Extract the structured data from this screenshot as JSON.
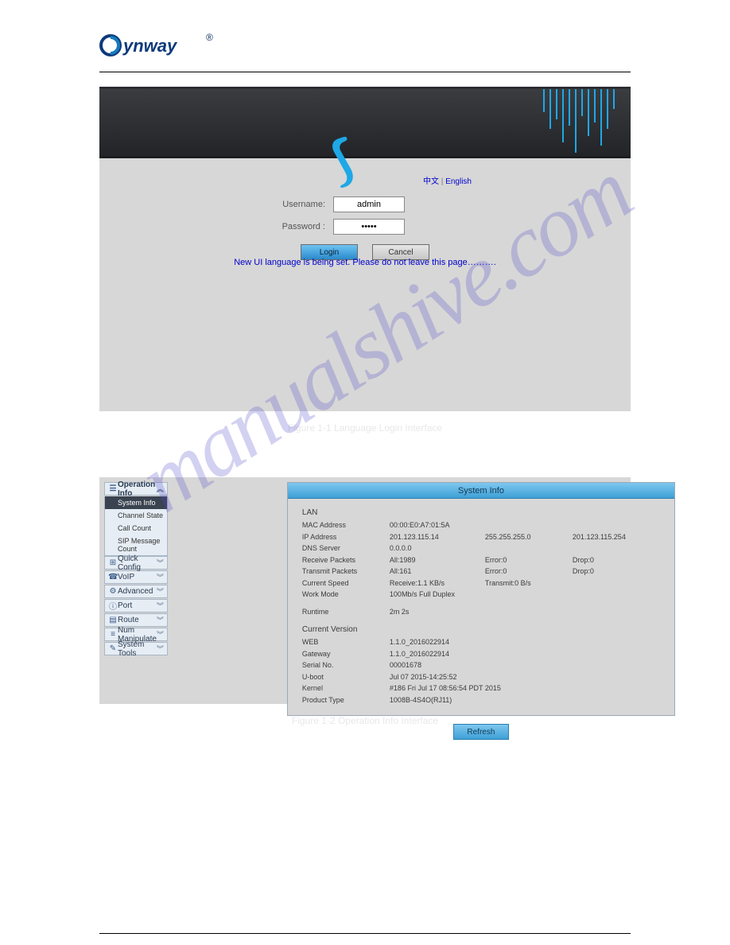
{
  "brand": "Synway",
  "login": {
    "lang_zh": "中文",
    "lang_sep": " | ",
    "lang_en": "English",
    "username_label": "Username:",
    "password_label": "Password :",
    "username_value": "admin",
    "password_value": "•••••",
    "login_btn": "Login",
    "cancel_btn": "Cancel",
    "loading_msg": "New UI language is being set. Please do not leave this page………."
  },
  "sidebar": {
    "groups": [
      {
        "icon": "☰",
        "label": "Operation Info",
        "expanded": true,
        "items": [
          "System Info",
          "Channel State",
          "Call Count",
          "SIP Message Count"
        ],
        "active_item": 0
      },
      {
        "icon": "⊞",
        "label": "Quick Config"
      },
      {
        "icon": "☎",
        "label": "VoIP"
      },
      {
        "icon": "⚙",
        "label": "Advanced"
      },
      {
        "icon": "ⓘ",
        "label": "Port"
      },
      {
        "icon": "▤",
        "label": "Route"
      },
      {
        "icon": "≡",
        "label": "Num Manipulate"
      },
      {
        "icon": "✎",
        "label": "System Tools"
      }
    ]
  },
  "system_info": {
    "title": "System Info",
    "lan_label": "LAN",
    "rows": {
      "mac": {
        "k": "MAC Address",
        "v1": "00:00:E0:A7:01:5A"
      },
      "ip": {
        "k": "IP Address",
        "v1": "201.123.115.14",
        "v2": "255.255.255.0",
        "v3": "201.123.115.254"
      },
      "dns": {
        "k": "DNS Server",
        "v1": "0.0.0.0"
      },
      "recv": {
        "k": "Receive Packets",
        "v1": "All:1989",
        "v2": "Error:0",
        "v3": "Drop:0"
      },
      "trans": {
        "k": "Transmit Packets",
        "v1": "All:161",
        "v2": "Error:0",
        "v3": "Drop:0"
      },
      "speed": {
        "k": "Current Speed",
        "v1": "Receive:1.1 KB/s",
        "v2": "Transmit:0 B/s"
      },
      "mode": {
        "k": "Work Mode",
        "v1": "100Mb/s Full Duplex"
      }
    },
    "runtime_label": "Runtime",
    "runtime_value": "2m 2s",
    "version_label": "Current Version",
    "versions": {
      "web": {
        "k": "WEB",
        "v": "1.1.0_2016022914"
      },
      "gateway": {
        "k": "Gateway",
        "v": "1.1.0_2016022914"
      },
      "serial": {
        "k": "Serial No.",
        "v": "00001678"
      },
      "uboot": {
        "k": "U-boot",
        "v": "Jul 07 2015-14:25:52"
      },
      "kernel": {
        "k": "Kernel",
        "v": "#186 Fri Jul 17 08:56:54 PDT 2015"
      },
      "product": {
        "k": "Product Type",
        "v": "1008B-4S4O(RJ11)"
      }
    },
    "refresh_btn": "Refresh"
  },
  "captions": {
    "fig1": "Figure 1-1 Language Login Interface",
    "fig2": "Figure 1-2 Operation Info Interface"
  },
  "watermark": "manualshive.com"
}
